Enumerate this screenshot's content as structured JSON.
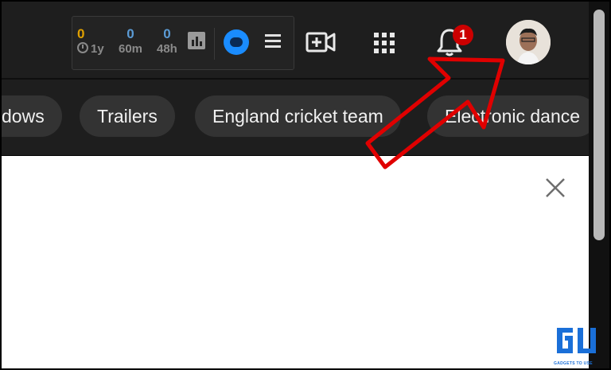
{
  "extension": {
    "stats": [
      {
        "value": "0",
        "label": "1y",
        "color": "#e0a000",
        "clock": true
      },
      {
        "value": "0",
        "label": "60m",
        "color": "#5b9bd5",
        "clock": false
      },
      {
        "value": "0",
        "label": "48h",
        "color": "#5b9bd5",
        "clock": false
      }
    ]
  },
  "header": {
    "notification_count": "1"
  },
  "chips": [
    {
      "label": "dows"
    },
    {
      "label": "Trailers"
    },
    {
      "label": "England cricket team"
    },
    {
      "label": "Electronic dance"
    }
  ],
  "watermark": {
    "sub_text": "GADGETS TO USE"
  },
  "icons": [
    "clock-icon",
    "bar-chart-icon",
    "extension-logo-icon",
    "menu-icon",
    "create-video-icon",
    "apps-grid-icon",
    "bell-icon",
    "close-icon",
    "red-arrow-annotation"
  ],
  "colors": {
    "dark_bg": "#1e1e1e",
    "chip_bg": "#333333",
    "badge": "#cc0000",
    "arrow": "#e00000"
  }
}
